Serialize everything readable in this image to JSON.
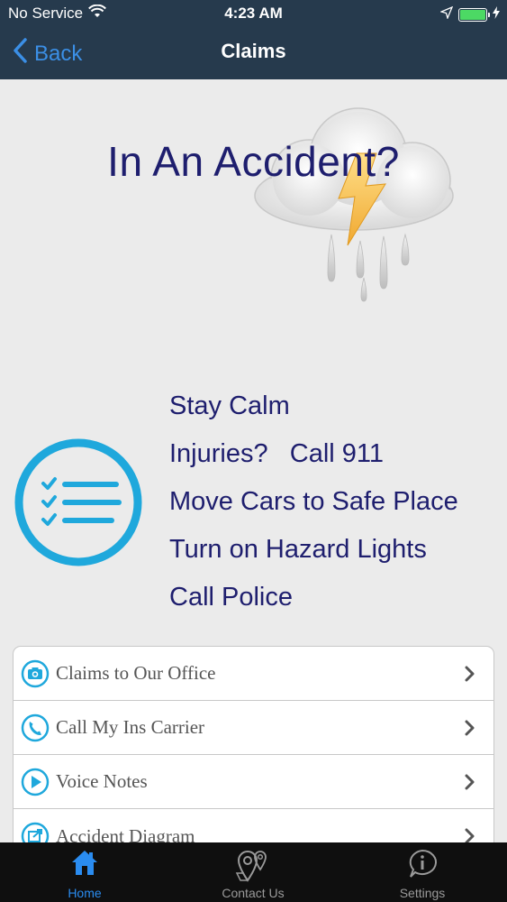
{
  "status_bar": {
    "carrier": "No Service",
    "time": "4:23 AM"
  },
  "nav": {
    "back_label": "Back",
    "title": "Claims"
  },
  "hero": {
    "title": "In An Accident?"
  },
  "steps": [
    "Stay Calm",
    "Injuries?   Call 911",
    "Move Cars to Safe Place",
    "Turn on Hazard Lights",
    "Call Police"
  ],
  "menu": {
    "items": [
      {
        "label": "Claims to Our Office",
        "icon": "camera-icon"
      },
      {
        "label": "Call My Ins Carrier",
        "icon": "phone-icon"
      },
      {
        "label": "Voice Notes",
        "icon": "play-icon"
      },
      {
        "label": "Accident Diagram",
        "icon": "diagram-icon"
      }
    ]
  },
  "tabbar": {
    "tabs": [
      {
        "label": "Home",
        "icon": "home-icon",
        "active": true
      },
      {
        "label": "Contact Us",
        "icon": "map-pin-icon",
        "active": false
      },
      {
        "label": "Settings",
        "icon": "info-icon",
        "active": false
      }
    ]
  },
  "colors": {
    "nav_background": "#263a4d",
    "accent_blue": "#3b8fe6",
    "heading_navy": "#1e1e6e",
    "icon_cyan": "#1fa8dc",
    "battery_green": "#4cd964",
    "tab_active": "#2a8cf0"
  }
}
